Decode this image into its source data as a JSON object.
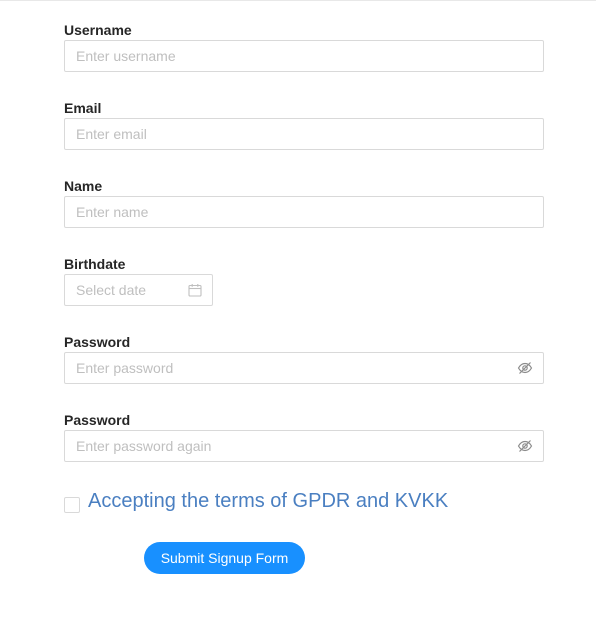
{
  "form": {
    "username": {
      "label": "Username",
      "placeholder": "Enter username",
      "value": ""
    },
    "email": {
      "label": "Email",
      "placeholder": "Enter email",
      "value": ""
    },
    "name": {
      "label": "Name",
      "placeholder": "Enter name",
      "value": ""
    },
    "birthdate": {
      "label": "Birthdate",
      "placeholder": "Select date",
      "value": "",
      "icon": "calendar-icon"
    },
    "password": {
      "label": "Password",
      "placeholder": "Enter password",
      "value": "",
      "icon": "eye-invisible-icon"
    },
    "password_confirm": {
      "label": "Password",
      "placeholder": "Enter password again",
      "value": "",
      "icon": "eye-invisible-icon"
    },
    "terms": {
      "label": "Accepting the terms of GPDR and KVKK",
      "checked": false
    },
    "submit_label": "Submit Signup Form"
  },
  "colors": {
    "primary": "#1890ff",
    "terms_text": "#4a7fc1",
    "border": "#d9d9d9",
    "placeholder": "#bfbfbf",
    "label": "#262626"
  }
}
